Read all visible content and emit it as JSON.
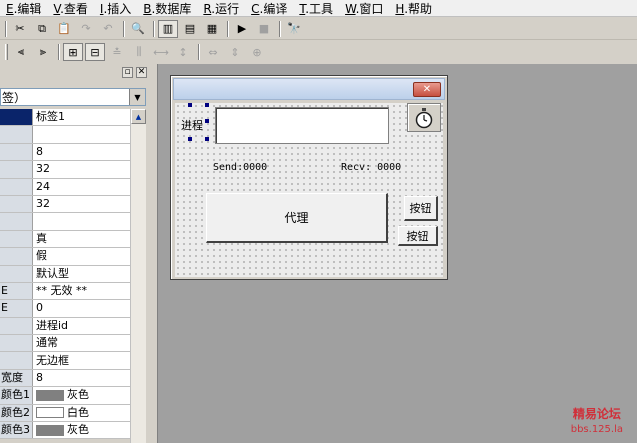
{
  "menu": [
    {
      "hot": "E",
      "label": ".编辑"
    },
    {
      "hot": "V",
      "label": ".查看"
    },
    {
      "hot": "I",
      "label": ".插入"
    },
    {
      "hot": "B",
      "label": ".数据库"
    },
    {
      "hot": "R",
      "label": ".运行"
    },
    {
      "hot": "C",
      "label": ".编译"
    },
    {
      "hot": "T",
      "label": ".工具"
    },
    {
      "hot": "W",
      "label": ".窗口"
    },
    {
      "hot": "H",
      "label": ".帮助"
    }
  ],
  "properties": {
    "combo_value": "签）",
    "rows": [
      {
        "key": "",
        "value": "标签1"
      },
      {
        "key": "",
        "value": ""
      },
      {
        "key": "",
        "value": "8"
      },
      {
        "key": "",
        "value": "32"
      },
      {
        "key": "",
        "value": "24"
      },
      {
        "key": "",
        "value": "32"
      },
      {
        "key": "",
        "value": ""
      },
      {
        "key": "",
        "value": "真"
      },
      {
        "key": "",
        "value": "假"
      },
      {
        "key": "",
        "value": "默认型"
      },
      {
        "key": "E",
        "value": "** 无效 **"
      },
      {
        "key": "E",
        "value": "0"
      },
      {
        "key": "",
        "value": "进程id"
      },
      {
        "key": "",
        "value": "通常"
      },
      {
        "key": "",
        "value": "无边框"
      },
      {
        "key": "宽度",
        "value": "8"
      },
      {
        "key": "颜色1",
        "value": "灰色"
      },
      {
        "key": "颜色2",
        "value": "白色"
      },
      {
        "key": "颜色3",
        "value": "灰色"
      }
    ],
    "swatch_colors": {
      "灰色": "#808080",
      "白色": "#ffffff"
    }
  },
  "form": {
    "label_process": "进程",
    "send_label": "Send:0000",
    "recv_label": "Recv: 0000",
    "proxy_button": "代理",
    "button1": "按钮",
    "button2": "按钮"
  },
  "watermark": {
    "line1": "精易论坛",
    "line2": "bbs.125.la"
  }
}
